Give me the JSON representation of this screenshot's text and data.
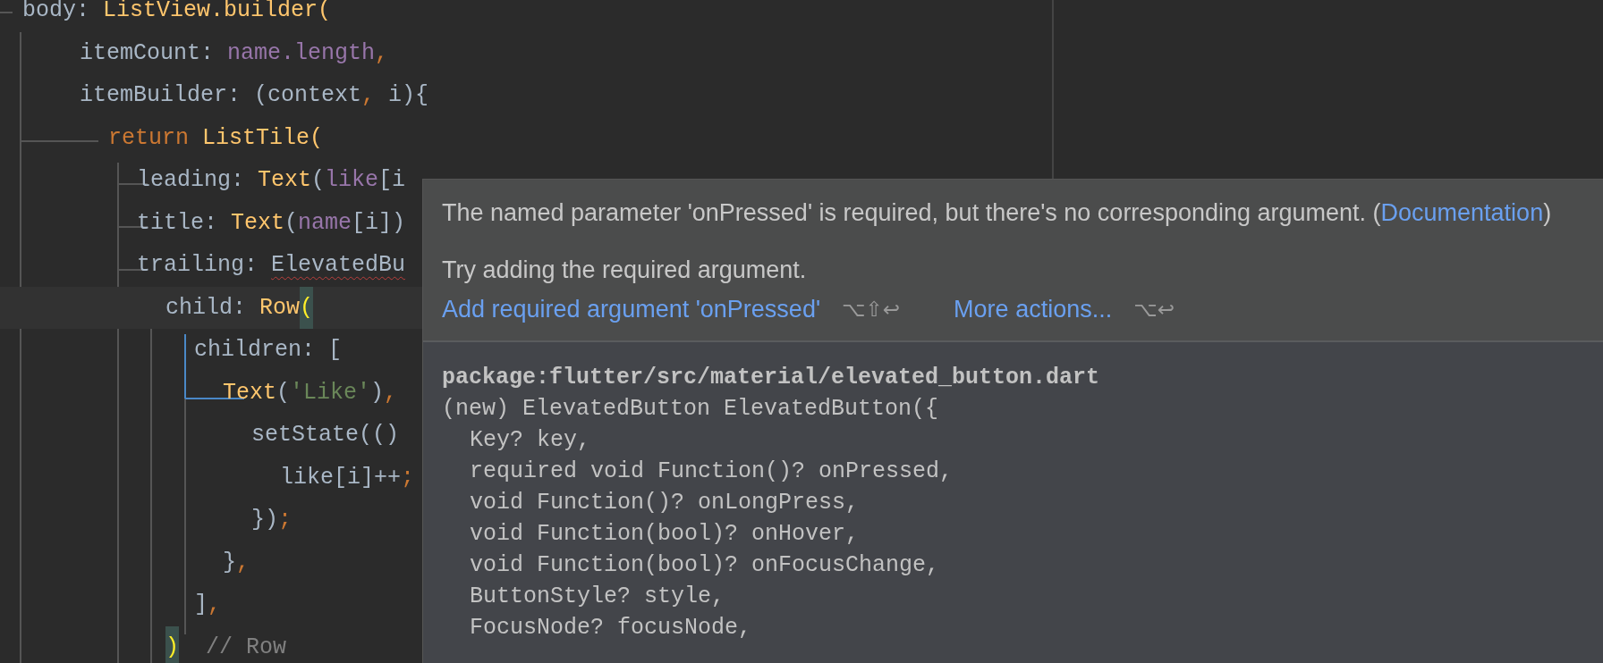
{
  "editor": {
    "lines": [
      {
        "current": false,
        "tokens": [
          {
            "text": "body: ",
            "kind": "plain"
          },
          {
            "text": "ListView.builder(",
            "kind": "class"
          }
        ]
      },
      {
        "current": false,
        "tokens": [
          {
            "text": "itemCount: ",
            "kind": "plain"
          },
          {
            "text": "name.length",
            "kind": "field"
          },
          {
            "text": ",",
            "kind": "punct"
          }
        ]
      },
      {
        "current": false,
        "tokens": [
          {
            "text": "itemBuilder: (context",
            "kind": "plain"
          },
          {
            "text": ",",
            "kind": "punct"
          },
          {
            "text": " i){",
            "kind": "plain"
          }
        ]
      },
      {
        "current": false,
        "tokens": [
          {
            "text": "return ",
            "kind": "keyword"
          },
          {
            "text": "ListTile(",
            "kind": "class"
          }
        ]
      },
      {
        "current": false,
        "tokens": [
          {
            "text": "leading: ",
            "kind": "plain"
          },
          {
            "text": "Text",
            "kind": "class"
          },
          {
            "text": "(",
            "kind": "plain"
          },
          {
            "text": "like",
            "kind": "field"
          },
          {
            "text": "[i",
            "kind": "plain"
          }
        ]
      },
      {
        "current": false,
        "tokens": [
          {
            "text": "title: ",
            "kind": "plain"
          },
          {
            "text": "Text",
            "kind": "class"
          },
          {
            "text": "(",
            "kind": "plain"
          },
          {
            "text": "name",
            "kind": "field"
          },
          {
            "text": "[i])",
            "kind": "plain"
          }
        ]
      },
      {
        "current": false,
        "tokens": [
          {
            "text": "trailing: ",
            "kind": "plain"
          },
          {
            "text": "ElevatedBu",
            "kind": "error"
          }
        ]
      },
      {
        "current": true,
        "tokens": [
          {
            "text": "child: ",
            "kind": "plain"
          },
          {
            "text": "Row",
            "kind": "class"
          },
          {
            "text": "(",
            "kind": "bracket"
          }
        ]
      },
      {
        "current": false,
        "tokens": [
          {
            "text": "children: [",
            "kind": "plain"
          }
        ]
      },
      {
        "current": false,
        "tokens": [
          {
            "text": "Text",
            "kind": "class"
          },
          {
            "text": "(",
            "kind": "plain"
          },
          {
            "text": "'Like'",
            "kind": "string"
          },
          {
            "text": ")",
            "kind": "plain"
          },
          {
            "text": ",",
            "kind": "punct"
          }
        ]
      },
      {
        "current": false,
        "tokens": [
          {
            "text": "setState(()",
            "kind": "plain"
          }
        ]
      },
      {
        "current": false,
        "tokens": [
          {
            "text": "like[i]++",
            "kind": "plain"
          },
          {
            "text": ";",
            "kind": "punct"
          }
        ]
      },
      {
        "current": false,
        "tokens": [
          {
            "text": "})",
            "kind": "plain"
          },
          {
            "text": ";",
            "kind": "punct"
          }
        ]
      },
      {
        "current": false,
        "tokens": [
          {
            "text": "}",
            "kind": "plain"
          },
          {
            "text": ",",
            "kind": "punct"
          }
        ]
      },
      {
        "current": false,
        "tokens": [
          {
            "text": "]",
            "kind": "plain"
          },
          {
            "text": ",",
            "kind": "punct"
          }
        ]
      },
      {
        "current": false,
        "tokens": [
          {
            "text": ")",
            "kind": "bracket"
          },
          {
            "text": "  // Row",
            "kind": "comment"
          }
        ]
      }
    ]
  },
  "popup": {
    "message": "The named parameter 'onPressed' is required, but there's no corresponding argument. (",
    "message_link": "Documentation",
    "message_end": ")",
    "hint": "Try adding the required argument.",
    "actions": [
      {
        "label": "Add required argument 'onPressed'",
        "shortcut": "⌥⇧↩"
      },
      {
        "label": "More actions...",
        "shortcut": "⌥↩"
      }
    ],
    "doc": [
      {
        "kind": "header",
        "text": "package:flutter/src/material/elevated_button.dart"
      },
      {
        "kind": "signature",
        "text": "(new) ElevatedButton ElevatedButton({"
      },
      {
        "kind": "param",
        "text": "Key? key,"
      },
      {
        "kind": "param",
        "text": "required void Function()? onPressed,"
      },
      {
        "kind": "param",
        "text": "void Function()? onLongPress,"
      },
      {
        "kind": "param",
        "text": "void Function(bool)? onHover,"
      },
      {
        "kind": "param",
        "text": "void Function(bool)? onFocusChange,"
      },
      {
        "kind": "param",
        "text": "ButtonStyle? style,"
      },
      {
        "kind": "param",
        "text": "FocusNode? focusNode,"
      }
    ]
  }
}
